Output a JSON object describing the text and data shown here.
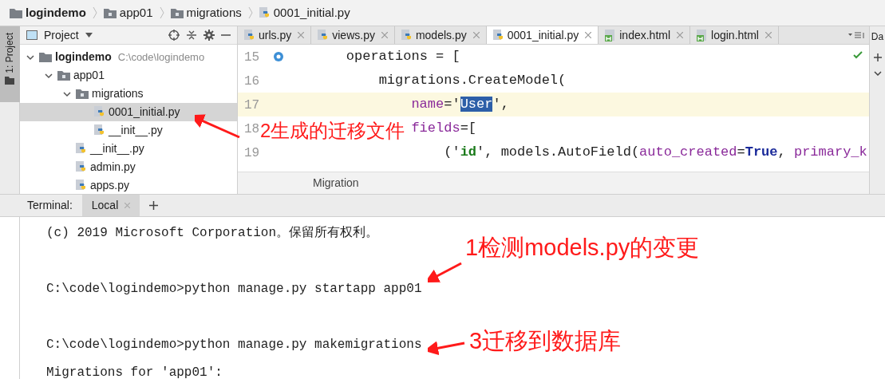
{
  "breadcrumbs": [
    {
      "label": "logindemo",
      "kind": "folder",
      "bold": true
    },
    {
      "label": "app01",
      "kind": "module",
      "bold": false
    },
    {
      "label": "migrations",
      "kind": "module",
      "bold": false
    },
    {
      "label": "0001_initial.py",
      "kind": "python",
      "bold": false
    }
  ],
  "side_strip": {
    "label": "1: Project"
  },
  "project_panel": {
    "title": "Project",
    "tree": [
      {
        "label": "logindemo",
        "path": "C:\\code\\logindemo",
        "kind": "folder",
        "expanded": true,
        "selected": false,
        "children": [
          {
            "label": "app01",
            "kind": "module",
            "expanded": true,
            "selected": false,
            "children": [
              {
                "label": "migrations",
                "kind": "module",
                "expanded": true,
                "selected": false,
                "children": [
                  {
                    "label": "0001_initial.py",
                    "kind": "python",
                    "selected": true
                  },
                  {
                    "label": "__init__.py",
                    "kind": "python",
                    "selected": false
                  }
                ]
              },
              {
                "label": "__init__.py",
                "kind": "python",
                "selected": false
              },
              {
                "label": "admin.py",
                "kind": "python",
                "selected": false
              },
              {
                "label": "apps.py",
                "kind": "python",
                "selected": false
              }
            ]
          }
        ]
      }
    ]
  },
  "editor": {
    "tabs": [
      {
        "label": "urls.py",
        "kind": "python",
        "selected": false
      },
      {
        "label": "views.py",
        "kind": "python",
        "selected": false
      },
      {
        "label": "models.py",
        "kind": "python",
        "selected": false
      },
      {
        "label": "0001_initial.py",
        "kind": "python",
        "selected": true
      },
      {
        "label": "index.html",
        "kind": "html",
        "selected": false
      },
      {
        "label": "login.html",
        "kind": "html",
        "selected": false
      }
    ],
    "lines": [
      {
        "number": "15",
        "current": false,
        "tokens": [
          {
            "text": "    operations = [",
            "kind": "plain"
          }
        ]
      },
      {
        "number": "16",
        "current": false,
        "tokens": [
          {
            "text": "        migrations.CreateModel(",
            "kind": "plain"
          }
        ]
      },
      {
        "number": "17",
        "current": true,
        "tokens": [
          {
            "text": "            name",
            "kind": "param"
          },
          {
            "text": "='",
            "kind": "plain"
          },
          {
            "text": "User",
            "kind": "selected"
          },
          {
            "text": "',",
            "kind": "plain"
          }
        ]
      },
      {
        "number": "18",
        "current": false,
        "tokens": [
          {
            "text": "            fields",
            "kind": "param"
          },
          {
            "text": "=[",
            "kind": "plain"
          }
        ]
      },
      {
        "number": "19",
        "current": false,
        "tokens": [
          {
            "text": "                ('",
            "kind": "plain"
          },
          {
            "text": "id",
            "kind": "string"
          },
          {
            "text": "', models.AutoField(",
            "kind": "plain"
          },
          {
            "text": "auto_created",
            "kind": "param"
          },
          {
            "text": "=",
            "kind": "plain"
          },
          {
            "text": "True",
            "kind": "keyword"
          },
          {
            "text": ", ",
            "kind": "plain"
          },
          {
            "text": "primary_k",
            "kind": "param"
          }
        ]
      }
    ],
    "breadcrumb": "Migration"
  },
  "right_strip": {
    "label": "Da"
  },
  "terminal": {
    "title": "Terminal:",
    "tabs": [
      {
        "label": "Local",
        "selected": true
      }
    ],
    "lines": [
      "(c) 2019 Microsoft Corporation。保留所有权利。",
      "C:\\code\\logindemo>python manage.py startapp app01",
      "C:\\code\\logindemo>python manage.py makemigrations",
      "Migrations for 'app01':"
    ]
  },
  "annotations": [
    {
      "text": "2生成的迁移文件"
    },
    {
      "text": "1检测models.py的变更"
    },
    {
      "text": "3迁移到数据库"
    }
  ]
}
